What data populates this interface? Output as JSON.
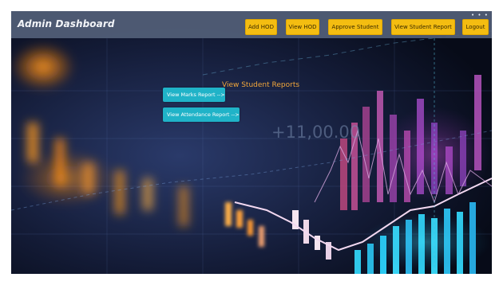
{
  "navbar": {
    "brand": "Admin Dashboard",
    "buttons": [
      {
        "label": "Add HOD"
      },
      {
        "label": "View HOD"
      },
      {
        "label": "Approve Student"
      },
      {
        "label": "View Student Report"
      },
      {
        "label": "Logout"
      }
    ],
    "color": "#535f78",
    "button_color": "#f4bd11",
    "more_icon": "more-dots-icon"
  },
  "main": {
    "title": "View Student Reports",
    "buttons": [
      {
        "label": "View Marks Report -->"
      },
      {
        "label": "View Attendance Report -->"
      }
    ],
    "button_color": "#20b3c8",
    "title_color": "#f1a63b"
  },
  "background": {
    "overlay_text": "+11,00.00"
  }
}
